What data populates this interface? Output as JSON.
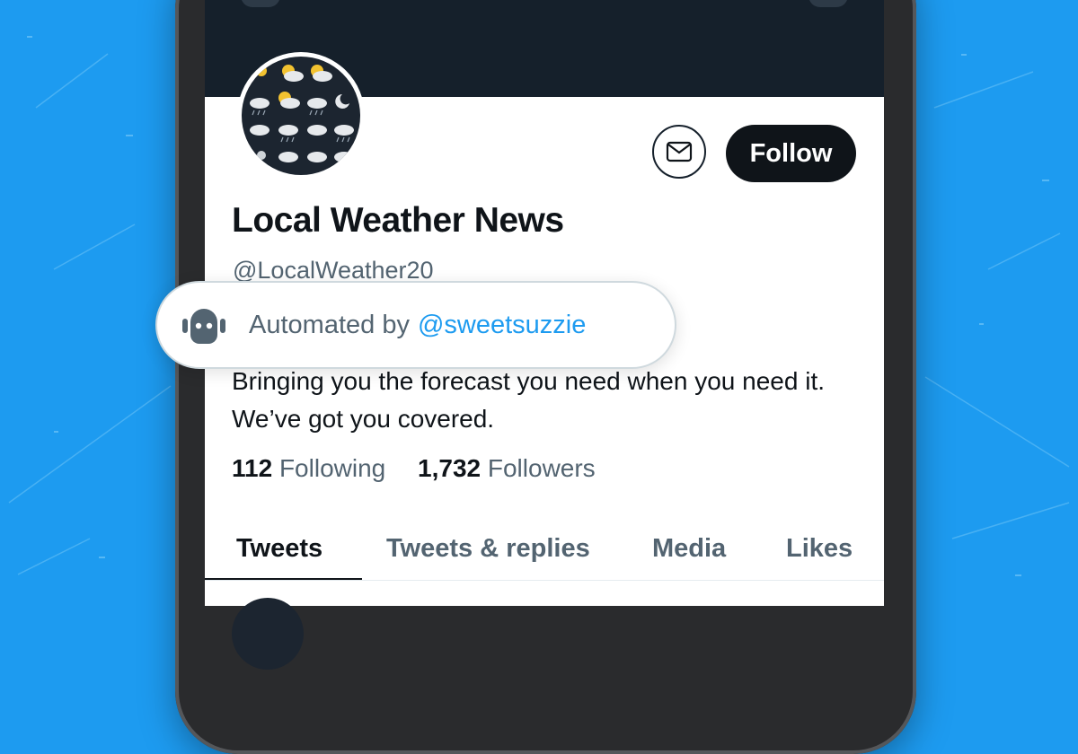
{
  "colors": {
    "background": "#1d9bf0",
    "accent_link": "#1d9bf0",
    "banner": "#15202b",
    "text_primary": "#0f1419",
    "text_secondary": "#536471"
  },
  "profile": {
    "display_name": "Local Weather News",
    "handle": "@LocalWeather20",
    "bio": "Bringing you the forecast you need when you need it.  We’ve got you covered.",
    "avatar_icon": "weather-icons-grid",
    "following_count": "112",
    "following_label": "Following",
    "followers_count": "1,732",
    "followers_label": "Followers"
  },
  "actions": {
    "message_icon": "envelope-icon",
    "follow_label": "Follow"
  },
  "automated_label": {
    "icon": "robot-icon",
    "prefix": "Automated by",
    "account": "@sweetsuzzie"
  },
  "tabs": [
    {
      "label": "Tweets",
      "active": true
    },
    {
      "label": "Tweets & replies",
      "active": false
    },
    {
      "label": "Media",
      "active": false
    },
    {
      "label": "Likes",
      "active": false
    }
  ]
}
